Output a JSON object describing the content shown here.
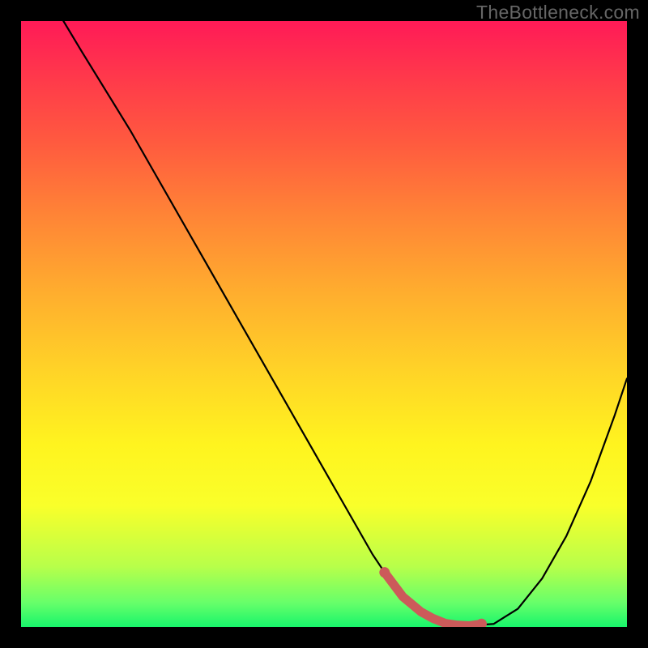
{
  "watermark": {
    "text": "TheBottleneck.com"
  },
  "colors": {
    "curve_stroke": "#000000",
    "marker_stroke": "#cc5a5a",
    "marker_fill": "none"
  },
  "chart_data": {
    "type": "line",
    "title": "",
    "xlabel": "",
    "ylabel": "",
    "xlim": [
      0,
      100
    ],
    "ylim": [
      0,
      100
    ],
    "grid": false,
    "series": [
      {
        "name": "bottleneck-curve",
        "x": [
          7,
          10,
          14,
          18,
          22,
          26,
          30,
          34,
          38,
          42,
          46,
          50,
          54,
          58,
          60,
          63,
          66,
          70,
          74,
          78,
          82,
          86,
          90,
          94,
          98,
          100
        ],
        "y": [
          100,
          95,
          88.5,
          82,
          75,
          68,
          61,
          54,
          47,
          40,
          33,
          26,
          19,
          12,
          9,
          5,
          2.5,
          0.5,
          0.2,
          0.5,
          3,
          8,
          15,
          24,
          35,
          41
        ]
      }
    ],
    "markers": {
      "name": "near-optimum-segment",
      "x": [
        60,
        63,
        66,
        68,
        70,
        72,
        74,
        76
      ],
      "y": [
        9,
        5,
        2.5,
        1.4,
        0.6,
        0.3,
        0.2,
        0.5
      ]
    }
  }
}
